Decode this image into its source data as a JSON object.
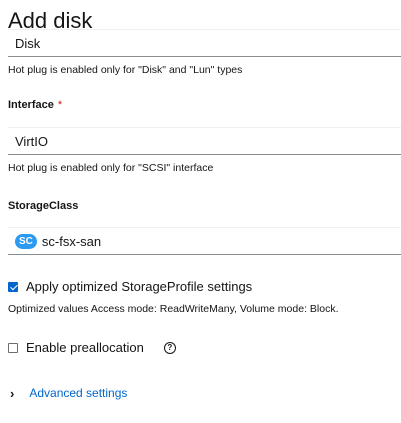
{
  "dialog": {
    "title": "Add disk"
  },
  "type_field": {
    "value": "Disk",
    "helper": "Hot plug is enabled only for \"Disk\" and \"Lun\" types"
  },
  "interface_field": {
    "label": "Interface",
    "required_mark": "*",
    "value": "VirtIO",
    "helper": "Hot plug is enabled only for \"SCSI\" interface"
  },
  "storage_class_field": {
    "label": "StorageClass",
    "badge": "SC",
    "value": "sc-fsx-san"
  },
  "optimized_profile": {
    "checked": true,
    "label": "Apply optimized StorageProfile settings",
    "description": "Optimized values Access mode: ReadWriteMany, Volume mode: Block."
  },
  "preallocation": {
    "checked": false,
    "label": "Enable preallocation",
    "help_icon": "question-circle-icon"
  },
  "advanced": {
    "label": "Advanced settings",
    "icon": "chevron-right-icon"
  },
  "colors": {
    "link": "#0066cc",
    "badge": "#2b9af3",
    "required": "#c9190b",
    "checkbox_checked": "#0066cc"
  }
}
